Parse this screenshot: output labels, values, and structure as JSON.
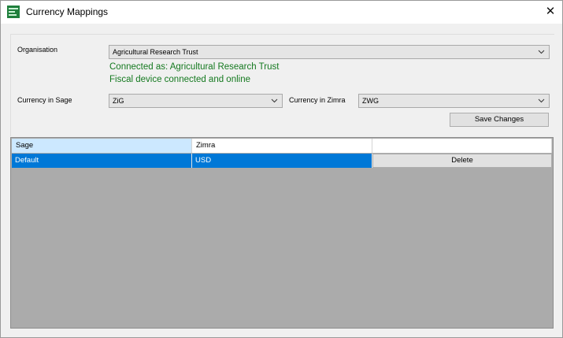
{
  "window": {
    "title": "Currency Mappings",
    "close_glyph": "✕",
    "icon": "sage-app-icon"
  },
  "form": {
    "organisation_label": "Organisation",
    "organisation_value": "Agricultural Research Trust",
    "connected_text": "Connected as: Agricultural Research Trust",
    "fiscal_text": "Fiscal device connected and online",
    "currency_sage_label": "Currency in Sage",
    "currency_sage_value": "ZiG",
    "currency_zimra_label": "Currency in Zimra",
    "currency_zimra_value": "ZWG",
    "save_label": "Save Changes",
    "status_color": "#14791f"
  },
  "grid": {
    "columns": [
      "Sage",
      "Zimra",
      ""
    ],
    "rows": [
      {
        "sage": "Default",
        "zimra": "USD",
        "action": "Delete"
      }
    ],
    "selected_color": "#0078d7",
    "background_color": "#ababab"
  }
}
